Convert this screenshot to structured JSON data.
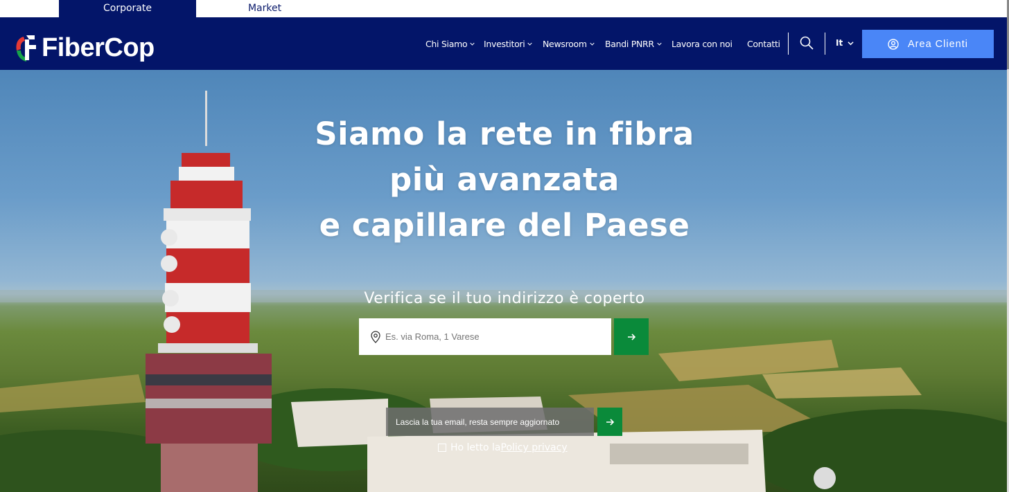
{
  "topbar": {
    "tabs": [
      {
        "label": "Corporate",
        "active": true
      },
      {
        "label": "Market",
        "active": false
      }
    ]
  },
  "header": {
    "logo_text": "FiberCop",
    "nav": [
      {
        "label": "Chi Siamo",
        "dropdown": true
      },
      {
        "label": "Investitori",
        "dropdown": true
      },
      {
        "label": "Newsroom",
        "dropdown": true
      },
      {
        "label": "Bandi PNRR",
        "dropdown": true
      },
      {
        "label": "Lavora con noi",
        "dropdown": false
      },
      {
        "label": "Contatti",
        "dropdown": false
      }
    ],
    "search_icon": "search-icon",
    "language": "It",
    "area_clienti": "Area Clienti"
  },
  "hero": {
    "title_lines": [
      "Siamo la rete in fibra",
      "più avanzata",
      "e capillare del Paese"
    ],
    "subtitle": "Verifica se il tuo indirizzo è coperto",
    "address_placeholder": "Es. via Roma, 1 Varese",
    "newsletter_placeholder": "Lascia la tua email, resta sempre aggiornato",
    "privacy_prefix": "Ho letto la ",
    "privacy_link": "Policy privacy"
  },
  "colors": {
    "navy": "#031569",
    "accent_blue": "#4a86f7",
    "green": "#0a8a3a"
  }
}
